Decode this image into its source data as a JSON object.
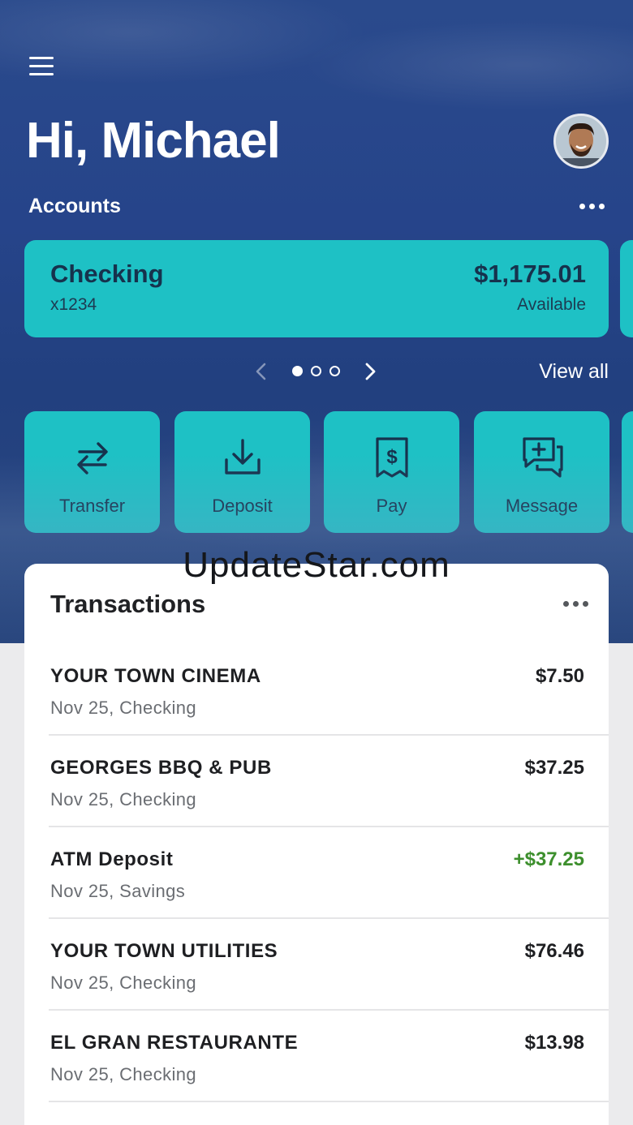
{
  "header": {
    "greeting": "Hi, Michael",
    "menu_icon": "hamburger-menu-icon",
    "avatar": "user-avatar"
  },
  "accounts": {
    "label": "Accounts",
    "more_icon": "more-horizontal-icon",
    "card": {
      "name": "Checking",
      "number": "x1234",
      "balance": "$1,175.01",
      "balance_label": "Available"
    },
    "pager": {
      "prev_icon": "chevron-left-icon",
      "next_icon": "chevron-right-icon",
      "pages": 3,
      "active_page": 1
    },
    "view_all": "View all"
  },
  "actions": [
    {
      "label": "Transfer",
      "icon": "transfer-arrows-icon"
    },
    {
      "label": "Deposit",
      "icon": "download-deposit-icon"
    },
    {
      "label": "Pay",
      "icon": "receipt-dollar-icon"
    },
    {
      "label": "Message",
      "icon": "message-plus-icon"
    }
  ],
  "watermark": "UpdateStar.com",
  "transactions": {
    "title": "Transactions",
    "more_icon": "more-horizontal-icon",
    "items": [
      {
        "merchant": "YOUR TOWN CINEMA",
        "meta": "Nov 25, Checking",
        "amount": "$7.50",
        "credit": false
      },
      {
        "merchant": "GEORGES BBQ & PUB",
        "meta": "Nov 25, Checking",
        "amount": "$37.25",
        "credit": false
      },
      {
        "merchant": "ATM Deposit",
        "meta": "Nov 25, Savings",
        "amount": "+$37.25",
        "credit": true
      },
      {
        "merchant": "YOUR TOWN UTILITIES",
        "meta": "Nov 25, Checking",
        "amount": "$76.46",
        "credit": false
      },
      {
        "merchant": "EL GRAN RESTAURANTE",
        "meta": "Nov 25, Checking",
        "amount": "$13.98",
        "credit": false
      }
    ]
  },
  "colors": {
    "hero_blue": "#26448a",
    "accent_teal": "#1ec1c5",
    "credit_green": "#3d8f2d"
  }
}
